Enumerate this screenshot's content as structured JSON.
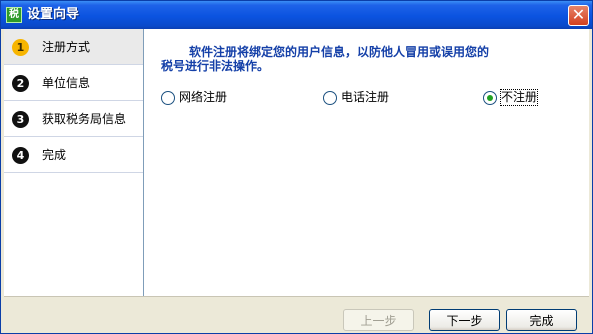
{
  "window": {
    "title": "设置向导",
    "app_icon_text": "税"
  },
  "steps": [
    {
      "num": "1",
      "label": "注册方式"
    },
    {
      "num": "2",
      "label": "单位信息"
    },
    {
      "num": "3",
      "label": "获取税务局信息"
    },
    {
      "num": "4",
      "label": "完成"
    }
  ],
  "main": {
    "notice_line1": "软件注册将绑定您的用户信息，以防他人冒用或误用您的",
    "notice_line2": "税号进行非法操作。",
    "options": [
      {
        "label": "网络注册",
        "selected": false
      },
      {
        "label": "电话注册",
        "selected": false
      },
      {
        "label": "不注册",
        "selected": true
      }
    ]
  },
  "buttons": {
    "prev": "上一步",
    "next": "下一步",
    "finish": "完成"
  },
  "colors": {
    "notice_text": "#1540a8",
    "titlebar": "#0b53e0",
    "active_step_badge": "#f7b500",
    "radio_dot": "#21a121"
  }
}
